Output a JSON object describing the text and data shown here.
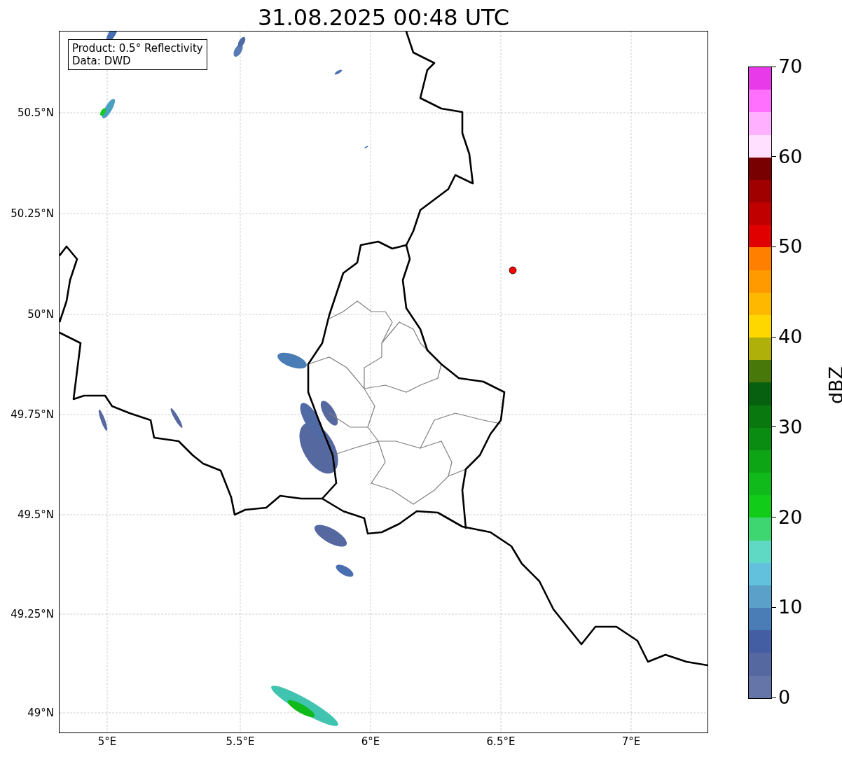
{
  "title": "31.08.2025 00:48 UTC",
  "info_box": {
    "lines": [
      "Product: 0.5° Reflectivity",
      "Data: DWD"
    ]
  },
  "map": {
    "x_ticks": [
      "5°E",
      "5.5°E",
      "6°E",
      "6.5°E",
      "7°E"
    ],
    "y_ticks": [
      "50.5°N",
      "50.25°N",
      "50°N",
      "49.75°N",
      "49.5°N",
      "49.25°N",
      "49°N"
    ]
  },
  "colorbar": {
    "label": "dBZ",
    "ticks": [
      "70",
      "60",
      "50",
      "40",
      "30",
      "20",
      "10",
      "0"
    ],
    "bins": [
      {
        "color": "#6675a8"
      },
      {
        "color": "#5568a0"
      },
      {
        "color": "#435ea3"
      },
      {
        "color": "#4a7cb5"
      },
      {
        "color": "#5aa0c8"
      },
      {
        "color": "#62c1dc"
      },
      {
        "color": "#5fd9c4"
      },
      {
        "color": "#3dd670"
      },
      {
        "color": "#12cc1a"
      },
      {
        "color": "#0fba1a"
      },
      {
        "color": "#0da515"
      },
      {
        "color": "#0a8c12"
      },
      {
        "color": "#08780f"
      },
      {
        "color": "#066010"
      },
      {
        "color": "#48780a"
      },
      {
        "color": "#b0b00a"
      },
      {
        "color": "#ffd700"
      },
      {
        "color": "#ffb800"
      },
      {
        "color": "#ff9a00"
      },
      {
        "color": "#ff7f00"
      },
      {
        "color": "#e00000"
      },
      {
        "color": "#c00000"
      },
      {
        "color": "#a00000"
      },
      {
        "color": "#780000"
      },
      {
        "color": "#ffe0ff"
      },
      {
        "color": "#ffb0ff"
      },
      {
        "color": "#ff70ff"
      },
      {
        "color": "#e83ae8"
      }
    ]
  }
}
